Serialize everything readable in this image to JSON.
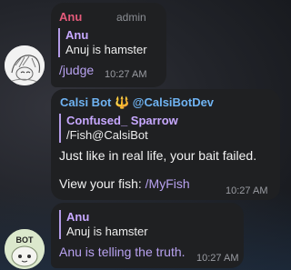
{
  "messages": [
    {
      "sender": "Anu",
      "role": "admin",
      "reply": {
        "name": "Anu",
        "text": "Anuj is hamster"
      },
      "text": "/judge",
      "time": "10:27 AM"
    },
    {
      "sender": "Calsi Bot",
      "sender_emoji": "🔱",
      "sender_handle": "@CalsiBotDev",
      "reply": {
        "name": "Confused_ Sparrow",
        "text": "/Fish@CalsiBot"
      },
      "line1": "Just like in real life, your bait failed.",
      "line2_prefix": "View your fish: ",
      "line2_cmd": "/MyFish",
      "time": "10:27 AM"
    },
    {
      "reply": {
        "name": "Anu",
        "text": "Anuj is hamster"
      },
      "text": "Anu is telling the truth.",
      "time": "10:27 AM"
    }
  ],
  "avatars": {
    "bot_label": "BOT"
  },
  "colors": {
    "anu_name": "#e35a7a",
    "bot_name": "#6fb3f2",
    "reply_accent": "#b39be6",
    "bubble": "#1f2022"
  }
}
